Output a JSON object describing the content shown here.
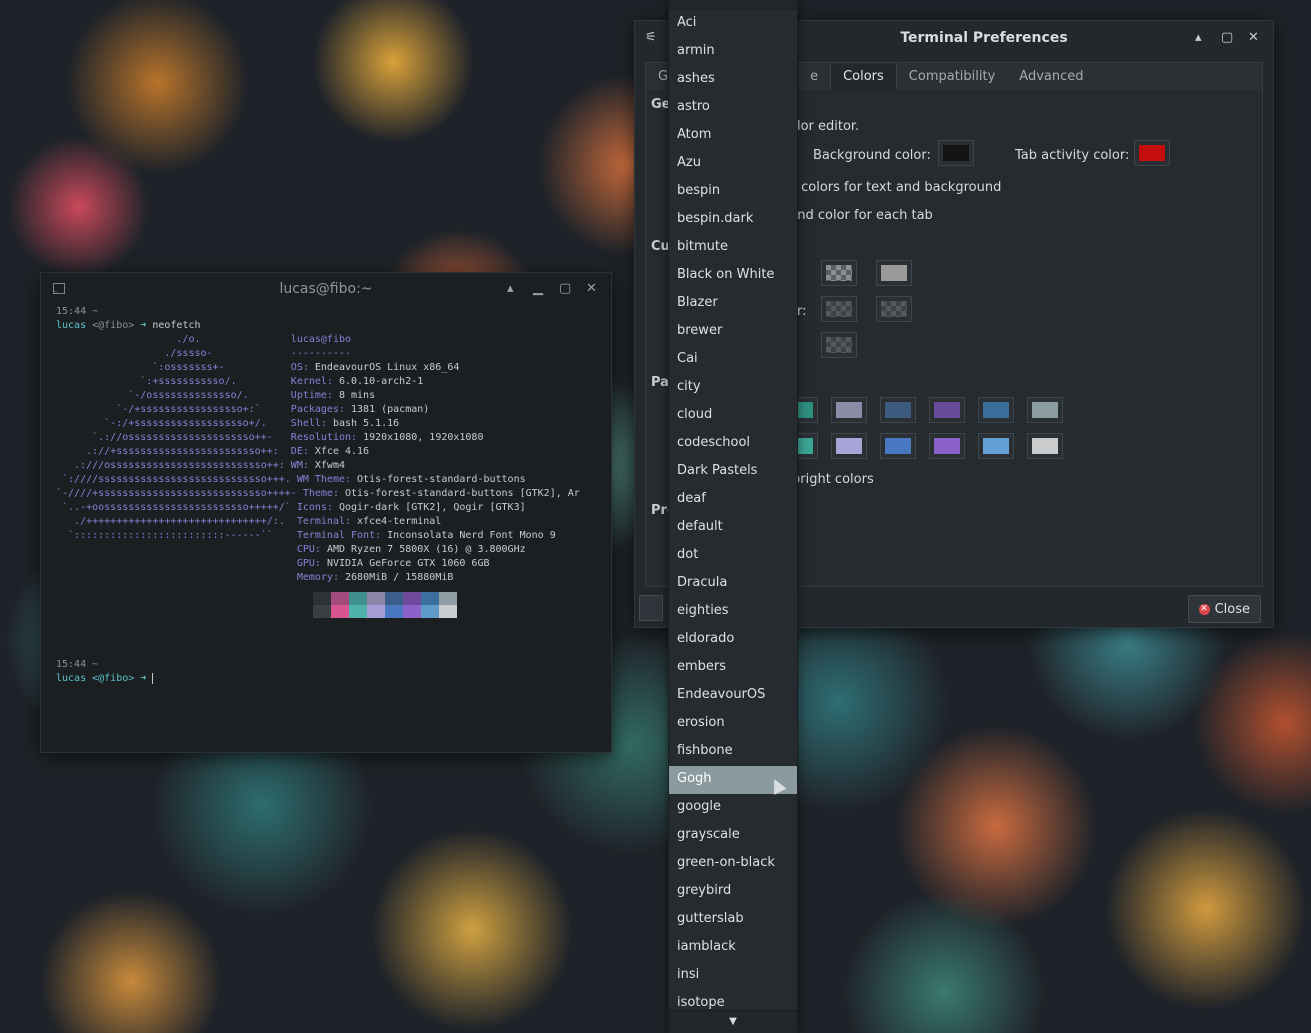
{
  "terminal": {
    "title": "lucas@fibo:~",
    "lines": [
      "",
      "15:44 ~",
      "lucas <@fibo> ➜ neofetch",
      "                    ./o.               lucas@fibo",
      "                  ./sssso-             ----------",
      "                `:osssssss+-           OS: EndeavourOS Linux x86_64",
      "              `:+sssssssssso/.         Kernel: 6.0.10-arch2-1",
      "            `-/ossssssssssssso/.       Uptime: 8 mins",
      "          `-/+sssssssssssssssso+:`     Packages: 1381 (pacman)",
      "        `-:/+sssssssssssssssssso+/.    Shell: bash 5.1.16",
      "      `.://osssssssssssssssssssso++-   Resolution: 1920x1080, 1920x1080",
      "     .://+ssssssssssssssssssssssso++:  DE: Xfce 4.16",
      "   .:///ossssssssssssssssssssssssso++: WM: Xfwm4",
      " `:////ssssssssssssssssssssssssssso+++. WM Theme: Otis-forest-standard-buttons",
      "`-////+ssssssssssssssssssssssssssso++++- Theme: Otis-forest-standard-buttons [GTK2], Ar",
      " `..-+oossssssssssssssssssssssso+++++/` Icons: Qogir-dark [GTK2], Qogir [GTK3]",
      "   ./++++++++++++++++++++++++++++++/:.  Terminal: xfce4-terminal",
      "  `:::::::::::::::::::::::::------``    Terminal Font: Inconsolata Nerd Font Mono 9",
      "                                        CPU: AMD Ryzen 7 5800X (16) @ 3.800GHz",
      "                                        GPU: NVIDIA GeForce GTX 1060 6GB",
      "                                        Memory: 2680MiB / 15880MiB"
    ],
    "prompt_time": "15:44 ~",
    "prompt": "lucas <@fibo> ➜ ",
    "palette_colors": [
      "#2e3236",
      "#a34a7c",
      "#3f8f8c",
      "#8d86a8",
      "#3c5e8c",
      "#6f4a9c",
      "#3a6f9e",
      "#8ea0a6",
      "#3a3f43",
      "#d7548f",
      "#4fb3ac",
      "#a59fd6",
      "#4a78c0",
      "#8a62c8",
      "#5f9cc9",
      "#c8ccce"
    ]
  },
  "prefs": {
    "title": "Terminal Preferences",
    "tabs": [
      "G",
      "e",
      "Colors",
      "Compatibility",
      "Advanced"
    ],
    "sections": [
      "Ge",
      "Cu",
      "Pal",
      "Pro"
    ],
    "texts": {
      "color_editor": "olor editor.",
      "background_color": "Background color:",
      "tab_activity_color": "Tab activity color:",
      "text_bg_colors": "e colors for text and background",
      "bg_each_tab": "und color for each tab",
      "or_label": "or:",
      "bright_colors": "bright colors"
    },
    "colors": {
      "background": "#121416",
      "tab_activity": "#c40e0e",
      "palette_row1": [
        "#2f8f7f",
        "#8c8ca8",
        "#3d5a80",
        "#6a4a9a",
        "#3c6e9c",
        "#8a9ca2"
      ],
      "palette_row2": [
        "#3aa594",
        "#a7a5d8",
        "#4a78c0",
        "#8a62c8",
        "#63a0d4",
        "#c9cbcc"
      ]
    },
    "close_label": "Close"
  },
  "dropdown": {
    "items": [
      "Aci",
      "armin",
      "ashes",
      "astro",
      "Atom",
      "Azu",
      "bespin",
      "bespin.dark",
      "bitmute",
      "Black on White",
      "Blazer",
      "brewer",
      "Cai",
      "city",
      "cloud",
      "codeschool",
      "Dark Pastels",
      "deaf",
      "default",
      "dot",
      "Dracula",
      "eighties",
      "eldorado",
      "embers",
      "EndeavourOS",
      "erosion",
      "fishbone",
      "Gogh",
      "google",
      "grayscale",
      "green-on-black",
      "greybird",
      "gutterslab",
      "iamblack",
      "insi",
      "isotope"
    ],
    "selected": "Gogh"
  }
}
